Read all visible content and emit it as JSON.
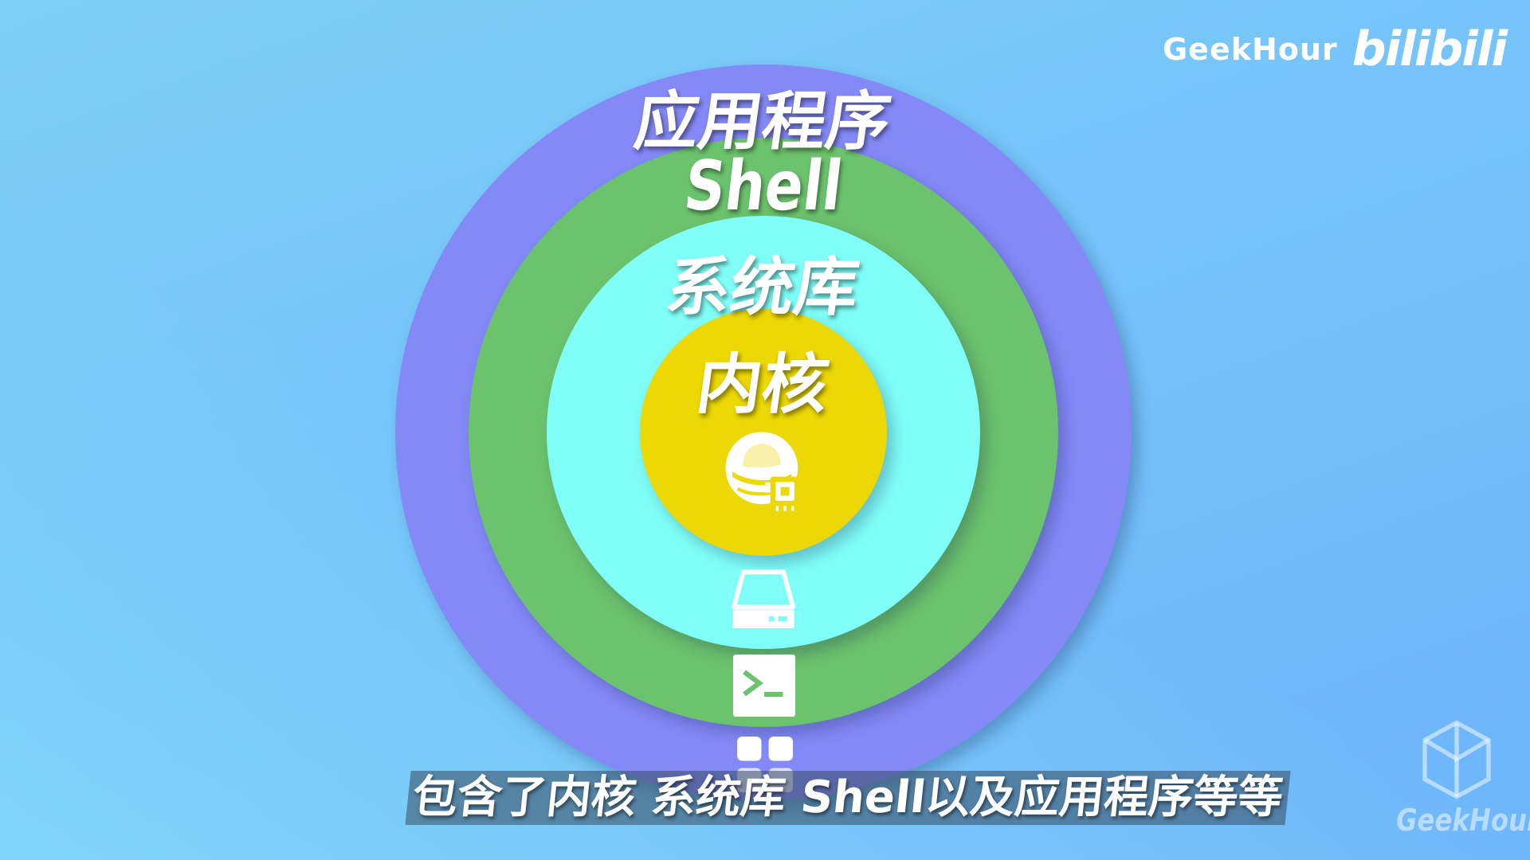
{
  "header": {
    "brand_name": "GeekHour",
    "brand_logo_text": "bilibili"
  },
  "diagram": {
    "layers": [
      {
        "label": "应用程序",
        "color": "#8489f8",
        "icon": "app-grid-icon"
      },
      {
        "label": "Shell",
        "color": "#6cc36d",
        "icon": "terminal-icon"
      },
      {
        "label": "系统库",
        "color": "#80fff9",
        "icon": "hard-drive-icon"
      },
      {
        "label": "内核",
        "color": "#ecd804",
        "icon": "redhat-chip-icon"
      }
    ]
  },
  "subtitle": {
    "text": "包含了内核 系统库 Shell以及应用程序等等"
  },
  "watermark": {
    "text": "GeekHour"
  }
}
